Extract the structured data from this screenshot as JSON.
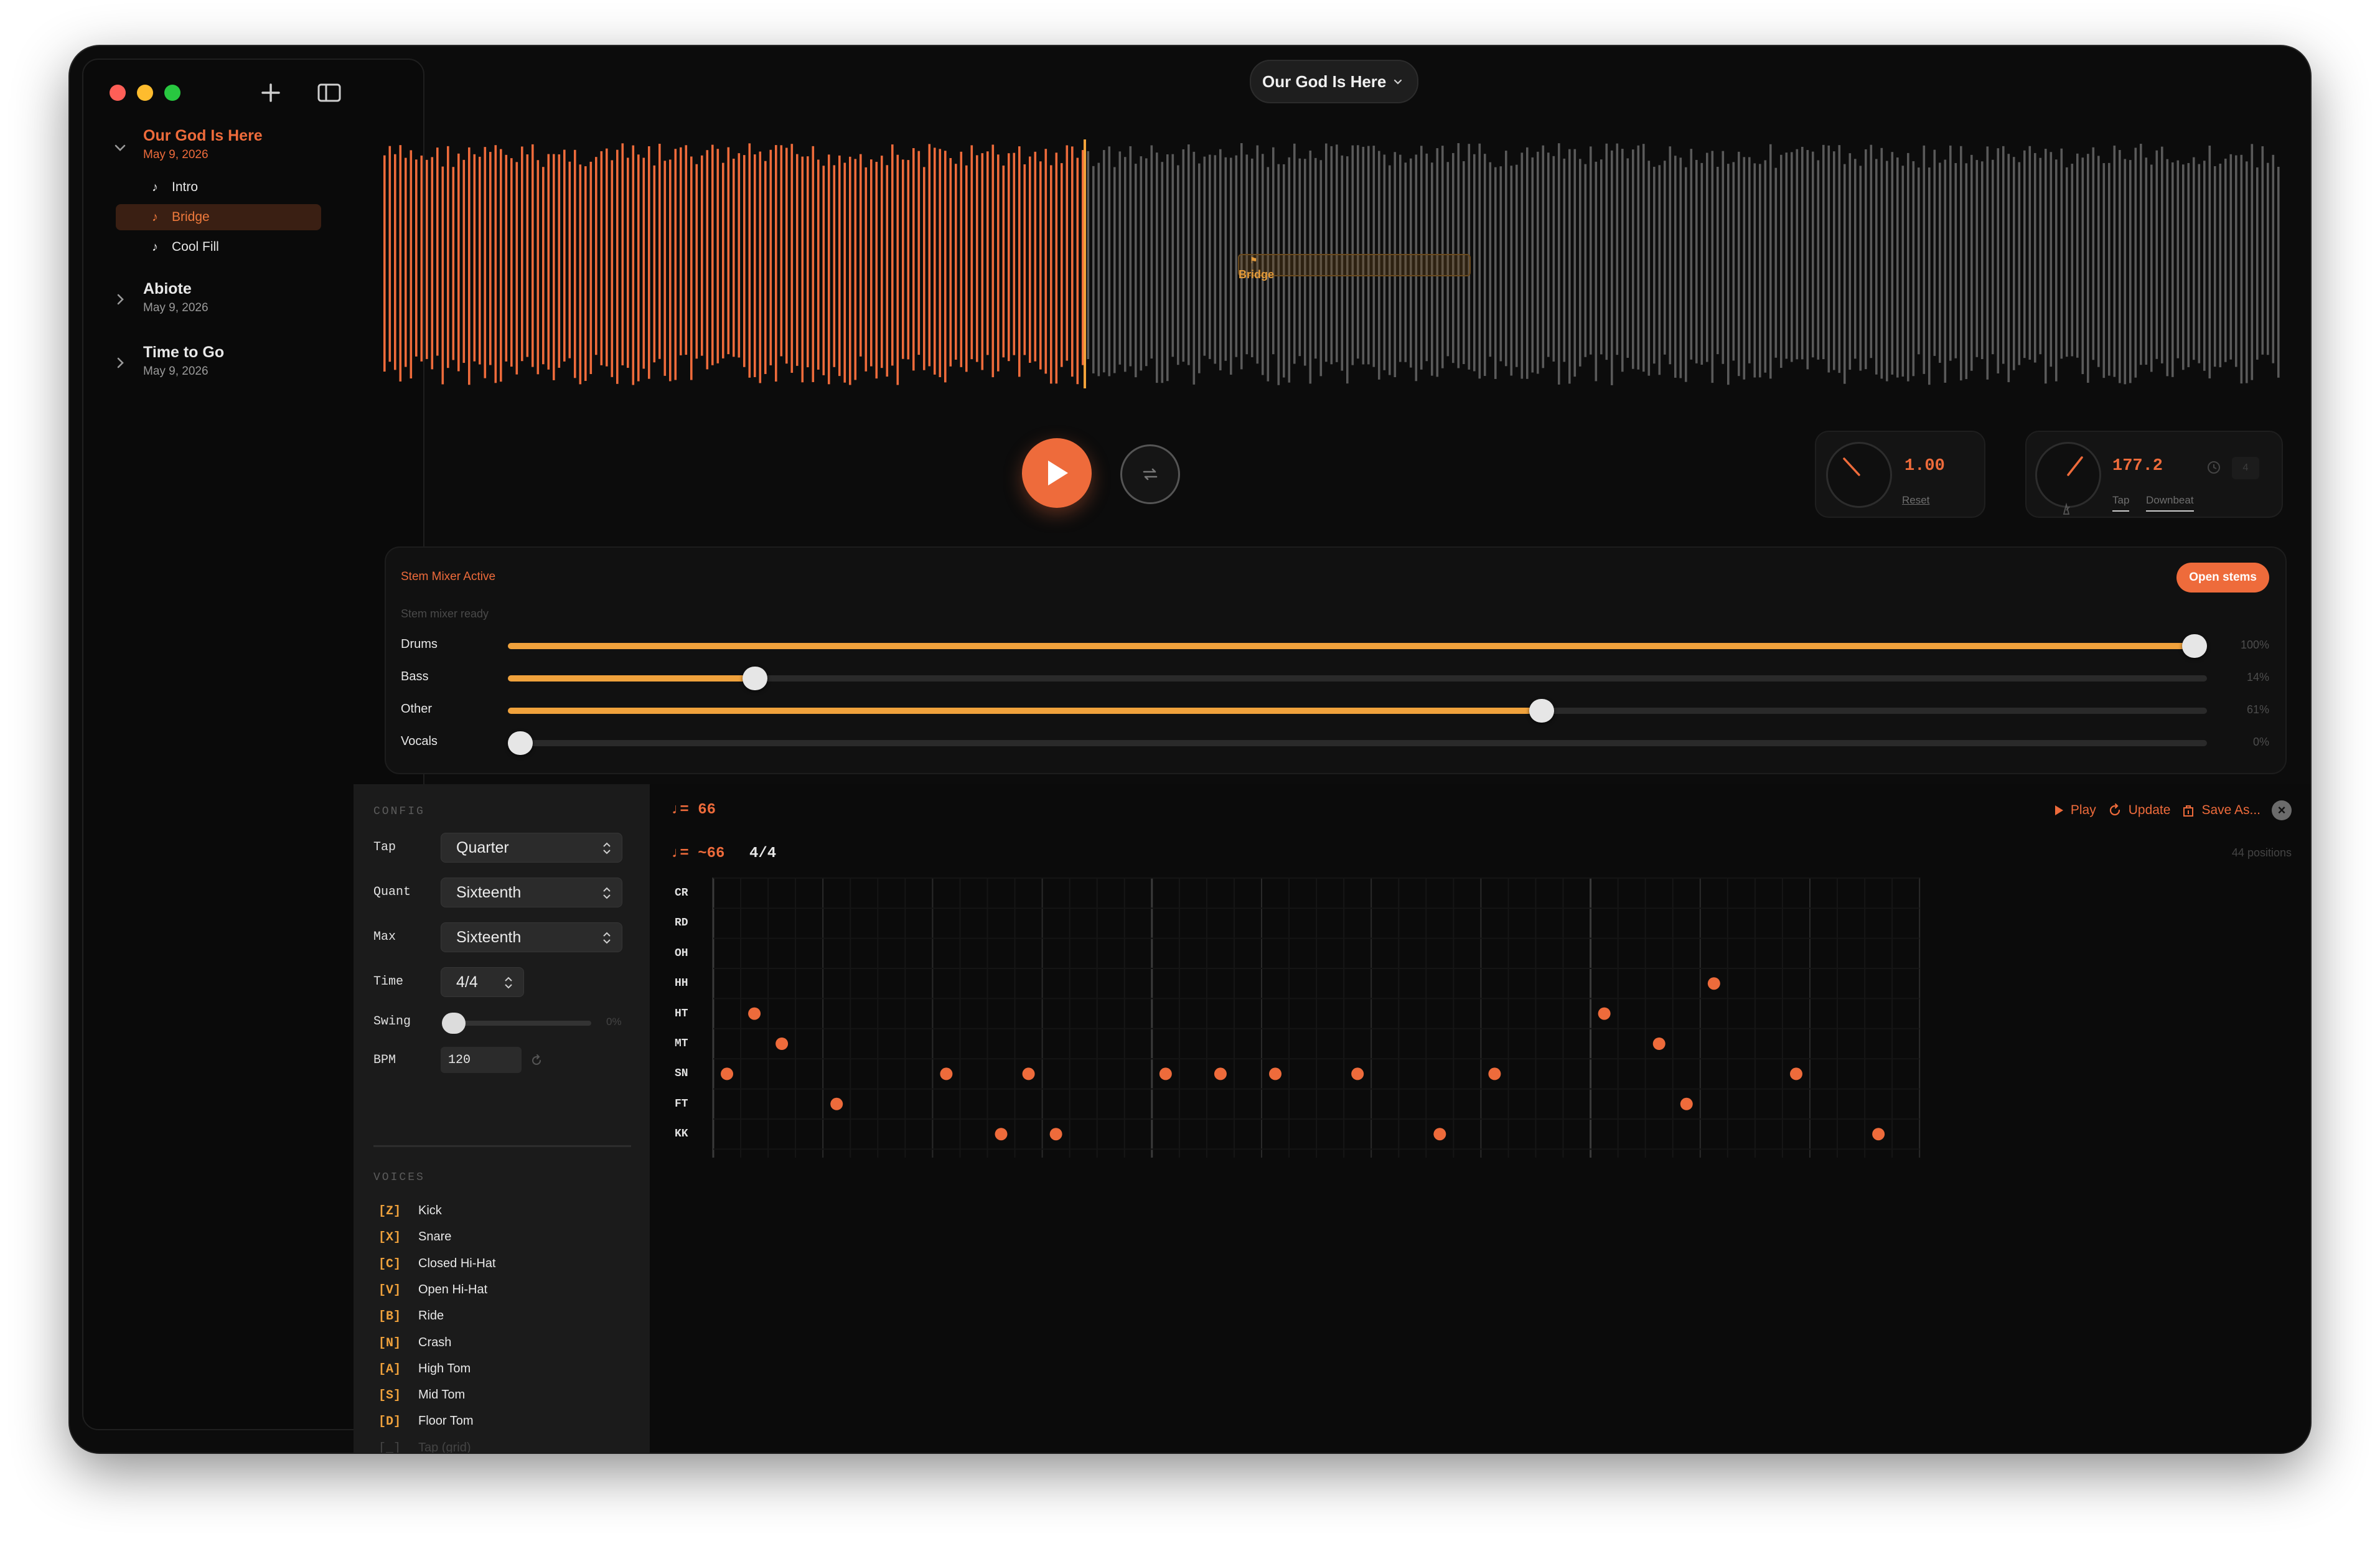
{
  "song_title_menu": "Our God Is Here",
  "sidebar": {
    "songs": [
      {
        "title": "Our God Is Here",
        "date": "May 9, 2026",
        "expanded": true,
        "sections": [
          {
            "label": "Intro",
            "selected": false
          },
          {
            "label": "Bridge",
            "selected": true
          },
          {
            "label": "Cool Fill",
            "selected": false
          }
        ]
      },
      {
        "title": "Abiote",
        "date": "May 9, 2026",
        "expanded": false
      },
      {
        "title": "Time to Go",
        "date": "May 9, 2026",
        "expanded": false
      }
    ]
  },
  "waveform": {
    "section_marker_label": "Bridge",
    "playhead_fraction": 0.37
  },
  "speed": {
    "value": "1.00",
    "reset_label": "Reset"
  },
  "tempo_knob": {
    "value": "177.2",
    "tap_label": "Tap",
    "downbeat_label": "Downbeat",
    "beats": "4"
  },
  "mixer": {
    "status": "Stem Mixer Active",
    "subtitle": "Stem mixer ready",
    "open_label": "Open stems",
    "stems": [
      {
        "name": "Drums",
        "percent": 100,
        "label": "100%"
      },
      {
        "name": "Bass",
        "percent": 14,
        "label": "14%"
      },
      {
        "name": "Other",
        "percent": 61,
        "label": "61%"
      },
      {
        "name": "Vocals",
        "percent": 0,
        "label": "0%"
      }
    ]
  },
  "config": {
    "heading": "CONFIG",
    "tap_label": "Tap",
    "tap_value": "Quarter",
    "quant_label": "Quant",
    "quant_value": "Sixteenth",
    "max_label": "Max",
    "max_value": "Sixteenth",
    "time_label": "Time",
    "time_value": "4/4",
    "swing_label": "Swing",
    "swing_value": "0%",
    "swing_percent": 0,
    "bpm_label": "BPM",
    "bpm_value": "120"
  },
  "voices": {
    "heading": "VOICES",
    "items": [
      {
        "key": "[Z]",
        "name": "Kick"
      },
      {
        "key": "[X]",
        "name": "Snare"
      },
      {
        "key": "[C]",
        "name": "Closed Hi-Hat"
      },
      {
        "key": "[V]",
        "name": "Open Hi-Hat"
      },
      {
        "key": "[B]",
        "name": "Ride"
      },
      {
        "key": "[N]",
        "name": "Crash"
      },
      {
        "key": "[A]",
        "name": "High Tom"
      },
      {
        "key": "[S]",
        "name": "Mid Tom"
      },
      {
        "key": "[D]",
        "name": "Floor Tom"
      },
      {
        "key": "[_]",
        "name": "Tap (grid)"
      }
    ]
  },
  "grid": {
    "tempo_top": "♩= 66",
    "tempo_est": "♩= ~66",
    "time_sig": "4/4",
    "play_label": "Play",
    "update_label": "Update",
    "save_label": "Save As...",
    "positions_label": "44 positions",
    "rows": [
      "CR",
      "RD",
      "OH",
      "HH",
      "HT",
      "MT",
      "SN",
      "FT",
      "KK"
    ],
    "hits": [
      {
        "row": "SN",
        "step": 0
      },
      {
        "row": "HT",
        "step": 1
      },
      {
        "row": "MT",
        "step": 2
      },
      {
        "row": "FT",
        "step": 4
      },
      {
        "row": "SN",
        "step": 8
      },
      {
        "row": "KK",
        "step": 10
      },
      {
        "row": "SN",
        "step": 11
      },
      {
        "row": "KK",
        "step": 12
      },
      {
        "row": "SN",
        "step": 16
      },
      {
        "row": "SN",
        "step": 18
      },
      {
        "row": "SN",
        "step": 20
      },
      {
        "row": "SN",
        "step": 23
      },
      {
        "row": "KK",
        "step": 26
      },
      {
        "row": "SN",
        "step": 28
      },
      {
        "row": "HT",
        "step": 32
      },
      {
        "row": "MT",
        "step": 34
      },
      {
        "row": "FT",
        "step": 35
      },
      {
        "row": "HH",
        "step": 36
      },
      {
        "row": "SN",
        "step": 39
      },
      {
        "row": "KK",
        "step": 42
      }
    ]
  },
  "colors": {
    "accent": "#ee6b3b",
    "amber": "#f0a23c"
  }
}
